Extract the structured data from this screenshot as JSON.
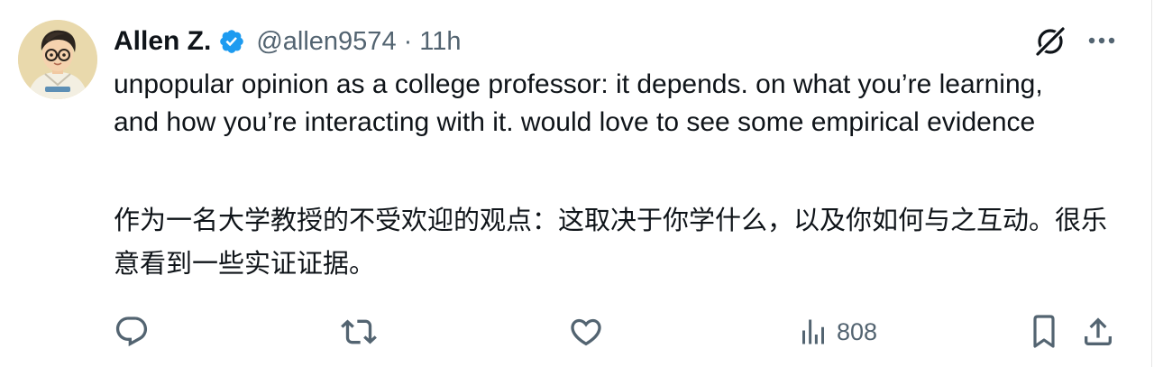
{
  "post": {
    "author": {
      "display_name": "Allen Z.",
      "handle": "@allen9574",
      "verified": true
    },
    "separator": "·",
    "time": "11h",
    "text": "unpopular opinion as a college professor: it depends. on what you’re learning, and how you’re interacting with it. would love to see some empirical evidence",
    "translation": "作为一名大学教授的不受欢迎的观点：这取决于你学什么，以及你如何与之互动。很乐意看到一些实证证据。"
  },
  "actions": {
    "views": "808"
  },
  "icons": {
    "avatar": "avatar-illustration",
    "verified": "verified-badge-icon",
    "grok": "grok-icon",
    "more": "more-icon",
    "reply": "reply-icon",
    "repost": "repost-icon",
    "like": "heart-icon",
    "views": "analytics-icon",
    "bookmark": "bookmark-icon",
    "share": "share-icon"
  },
  "colors": {
    "text_primary": "#0f1419",
    "text_secondary": "#536471",
    "verified_blue": "#1d9bf0"
  }
}
